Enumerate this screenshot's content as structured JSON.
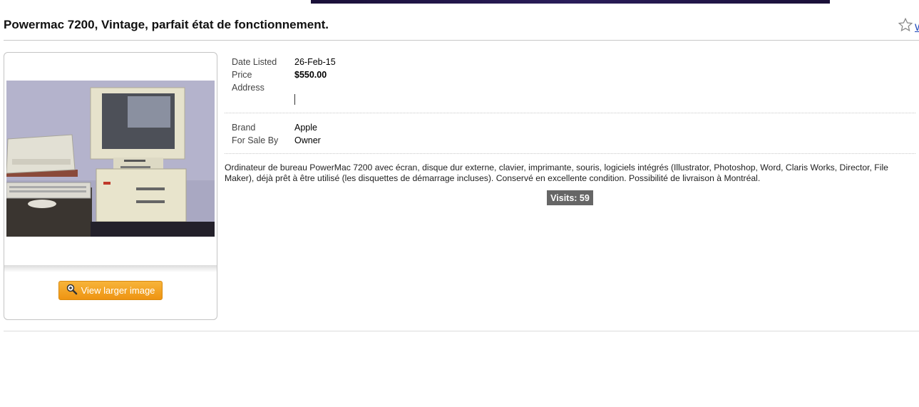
{
  "listing": {
    "title": "Powermac 7200, Vintage, parfait état de fonctionnement.",
    "watch_label": "W"
  },
  "details": {
    "date_listed_label": "Date Listed",
    "date_listed_value": "26-Feb-15",
    "price_label": "Price",
    "price_value": "$550.00",
    "address_label": "Address",
    "brand_label": "Brand",
    "brand_value": "Apple",
    "for_sale_by_label": "For Sale By",
    "for_sale_by_value": "Owner"
  },
  "description": "Ordinateur de bureau PowerMac 7200 avec écran, disque dur externe, clavier, imprimante, souris, logiciels intégrés (Illustrator, Photoshop, Word, Claris Works, Director, File Maker), déjà prêt à être utilisé (les disquettes de démarrage incluses). Conservé en excellente condition. Possibilité de livraison à Montréal.",
  "visits_label": "Visits: 59",
  "image_panel": {
    "view_button_label": "View larger image"
  },
  "icons": {
    "watch": "star-outline-icon",
    "zoom": "magnifier-plus-icon"
  },
  "colors": {
    "button": "#f0a020",
    "visits_badge": "#666666",
    "link": "#1a44b8"
  }
}
